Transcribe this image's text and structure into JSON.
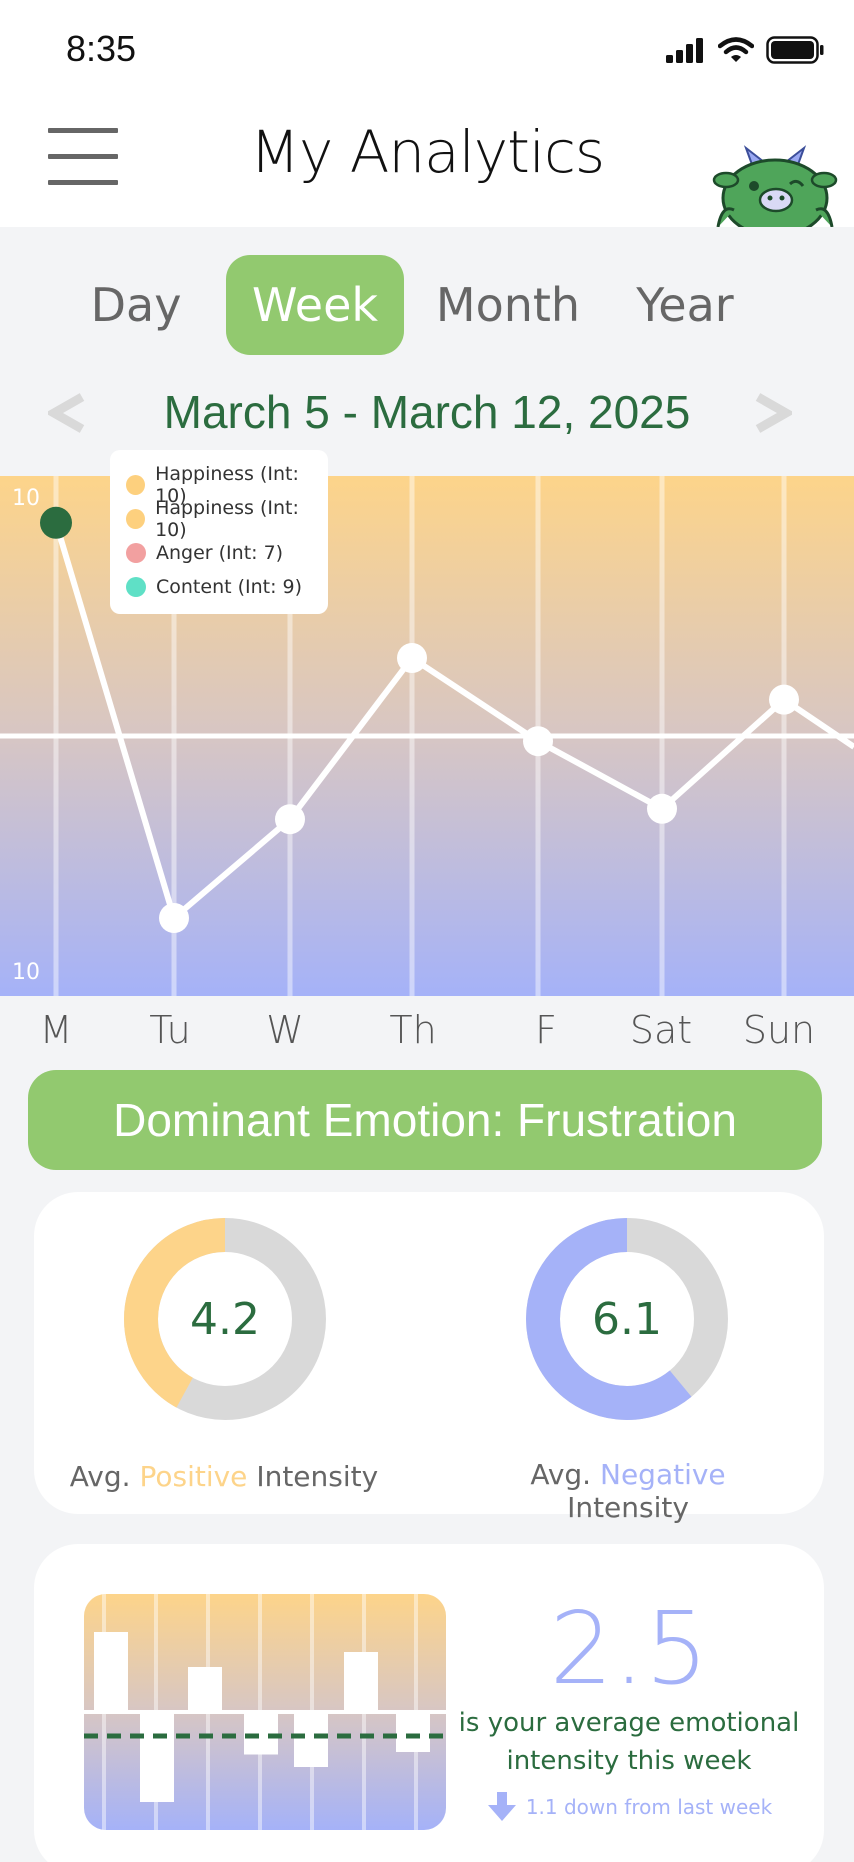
{
  "status": {
    "time": "8:35"
  },
  "header": {
    "title": "My Analytics"
  },
  "tabs": [
    {
      "label": "Day",
      "active": false
    },
    {
      "label": "Week",
      "active": true
    },
    {
      "label": "Month",
      "active": false
    },
    {
      "label": "Year",
      "active": false
    }
  ],
  "date_range": "March 5 - March 12, 2025",
  "tooltip": [
    {
      "label": "Happiness (Int: 10)",
      "color": "#fdd07e"
    },
    {
      "label": "Happiness (Int: 10)",
      "color": "#fdd07e"
    },
    {
      "label": "Anger (Int: 7)",
      "color": "#f2a0a0"
    },
    {
      "label": "Content (Int: 9)",
      "color": "#5fe0c6"
    }
  ],
  "chart_data": {
    "type": "line",
    "categories": [
      "M",
      "Tu",
      "W",
      "Th",
      "F",
      "Sat",
      "Sun"
    ],
    "values": [
      9.1,
      1.5,
      3.4,
      6.5,
      4.9,
      3.6,
      5.7
    ],
    "y_top_label": "10",
    "y_bottom_label": "10",
    "ylim": [
      0,
      10
    ],
    "baseline": 5,
    "highlight_index": 0,
    "colors": {
      "top": "#fdd48a",
      "bottom": "#a5b2f8",
      "line": "#ffffff",
      "highlight": "#2b6c3f"
    }
  },
  "dominant_emotion": "Dominant Emotion: Frustration",
  "positive": {
    "value": "4.2",
    "fraction": 0.42,
    "caption_prefix": "Avg. ",
    "caption_word": "Positive",
    "caption_suffix": " Intensity",
    "color": "#fdd48a"
  },
  "negative": {
    "value": "6.1",
    "fraction": 0.61,
    "caption_prefix": "Avg. ",
    "caption_word": "Negative",
    "caption_suffix": " Intensity",
    "color": "#a5b2f8"
  },
  "mini_bars": [
    3.2,
    -3.6,
    1.8,
    -1.7,
    -2.2,
    2.4,
    -1.6
  ],
  "average": {
    "value": "2.5",
    "text": "is your average emotional intensity this week",
    "change": "1.1 down from last week"
  }
}
